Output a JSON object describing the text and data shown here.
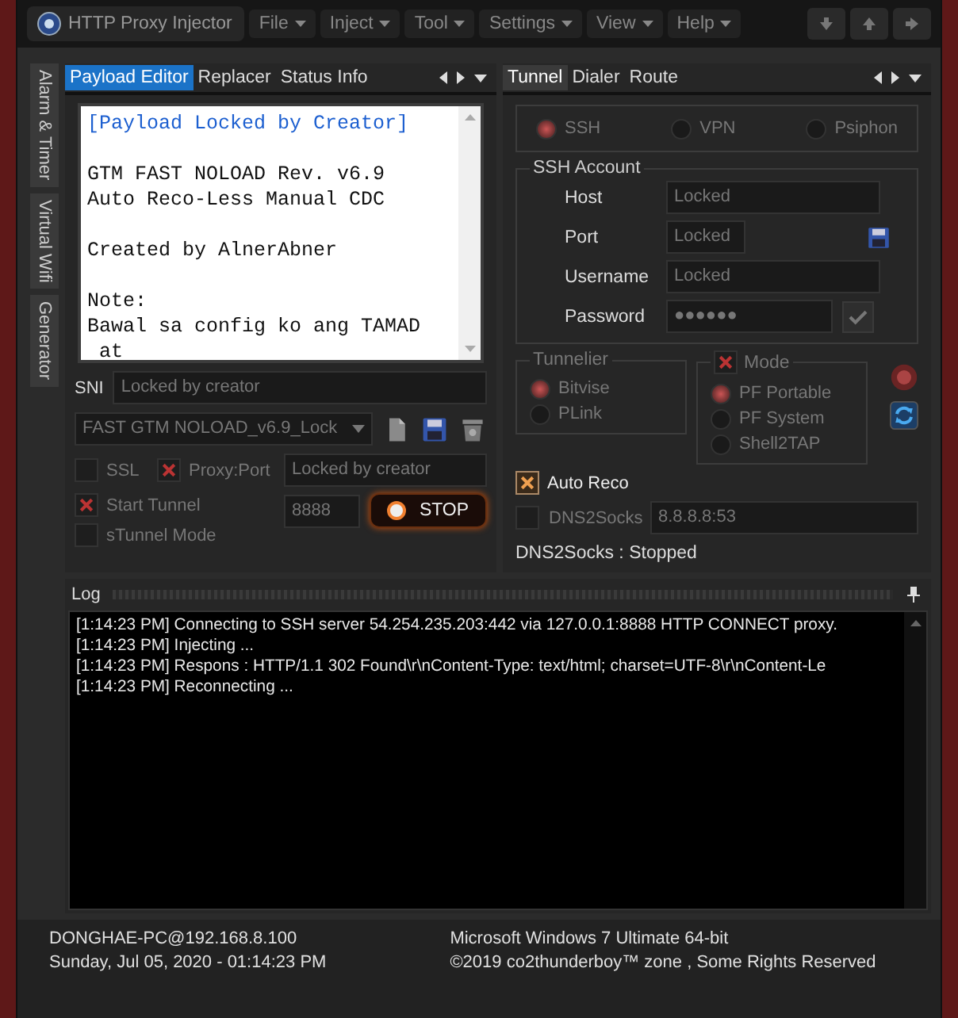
{
  "window": {
    "title": "HTTP Proxy Injector"
  },
  "menus": [
    "File",
    "Inject",
    "Tool",
    "Settings",
    "View",
    "Help"
  ],
  "side_tabs": [
    {
      "label": "Alarm & Timer",
      "selected": false
    },
    {
      "label": "Virtual Wifi",
      "selected": false
    },
    {
      "label": "Generator",
      "selected": false
    }
  ],
  "left_tabs": [
    {
      "label": "Payload Editor",
      "selected": true
    },
    {
      "label": "Replacer",
      "selected": false
    },
    {
      "label": "Status Info",
      "selected": false
    }
  ],
  "payload": {
    "header": "[Payload Locked by Creator]",
    "paragraphs": [
      [
        "GTM FAST NOLOAD Rev. v6.9",
        "Auto Reco-Less Manual CDC"
      ],
      [
        "Created by AlnerAbner"
      ],
      [
        "Note:",
        "Bawal sa config ko ang TAMAD",
        " at"
      ]
    ]
  },
  "sni": {
    "label": "SNI",
    "value": "Locked by creator"
  },
  "config": {
    "value": "FAST GTM NOLOAD_v6.9_Lock"
  },
  "options": [
    {
      "label": "SSL",
      "checked": false
    },
    {
      "label": "Proxy:Port",
      "checked": true
    },
    {
      "label": "Start Tunnel",
      "checked": true
    },
    {
      "label": "sTunnel Mode",
      "checked": false
    }
  ],
  "proxy": {
    "host": "Locked by creator",
    "port": "8888"
  },
  "stop_button": "STOP",
  "right_tabs": [
    {
      "label": "Tunnel",
      "selected": true
    },
    {
      "label": "Dialer",
      "selected": false
    },
    {
      "label": "Route",
      "selected": false
    }
  ],
  "protocols": [
    {
      "label": "SSH",
      "selected": true
    },
    {
      "label": "VPN",
      "selected": false
    },
    {
      "label": "Psiphon",
      "selected": false
    }
  ],
  "ssh_account": {
    "title": "SSH Account",
    "fields": [
      {
        "label": "Host",
        "value": "Locked"
      },
      {
        "label": "Port",
        "value": "Locked"
      },
      {
        "label": "Username",
        "value": "Locked"
      },
      {
        "label": "Password",
        "value": "●●●●●●"
      }
    ]
  },
  "tunnelier": {
    "title": "Tunnelier",
    "items": [
      {
        "label": "Bitvise",
        "selected": true
      },
      {
        "label": "PLink",
        "selected": false
      }
    ]
  },
  "mode": {
    "title": "Mode",
    "checked": true,
    "items": [
      {
        "label": "PF Portable",
        "selected": true
      },
      {
        "label": "PF System",
        "selected": false
      },
      {
        "label": "Shell2TAP",
        "selected": false
      }
    ]
  },
  "auto_reco": {
    "label": "Auto Reco",
    "checked": true
  },
  "dns2socks": {
    "label": "DNS2Socks",
    "checked": false,
    "value": "8.8.8.8:53",
    "status": "DNS2Socks : Stopped"
  },
  "log": {
    "title": "Log",
    "lines": [
      "[1:14:23 PM] Connecting to SSH server 54.254.235.203:442 via 127.0.0.1:8888 HTTP CONNECT proxy.",
      "[1:14:23 PM] Injecting ...",
      "[1:14:23 PM] Respons : HTTP/1.1 302 Found\\r\\nContent-Type: text/html; charset=UTF-8\\r\\nContent-Le",
      "[1:14:23 PM] Reconnecting ..."
    ]
  },
  "status_bar": {
    "host": "DONGHAE-PC@192.168.8.100",
    "datetime": "Sunday, Jul 05, 2020 - 01:14:23 PM",
    "os": "Microsoft Windows 7 Ultimate  64-bit",
    "copyright": "©2019 co2thunderboy™ zone , Some Rights Reserved"
  }
}
